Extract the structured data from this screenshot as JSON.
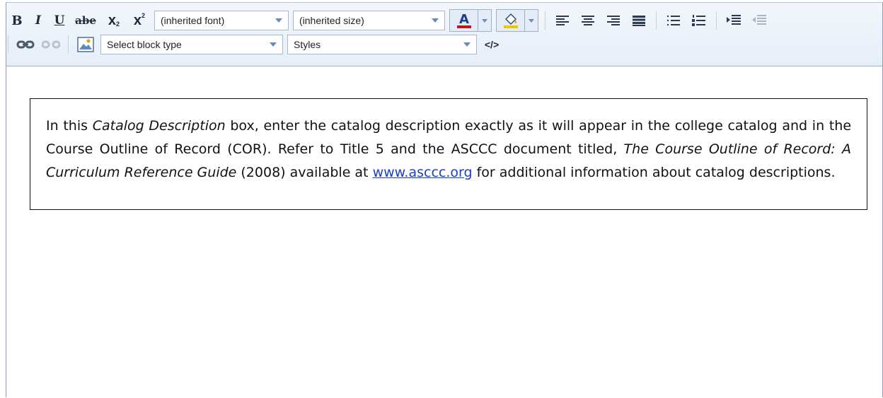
{
  "toolbar": {
    "bold": "B",
    "italic": "I",
    "underline": "U",
    "strike": "abe",
    "subscript_main": "x",
    "subscript_small": "2",
    "superscript_main": "x",
    "superscript_small": "2",
    "font_select": "(inherited font)",
    "size_select": "(inherited size)",
    "font_color_glyph": "A",
    "font_color": "#c01818",
    "block_select": "Select block type",
    "styles_select": "Styles",
    "source_glyph": "</>"
  },
  "content": {
    "p1": "In this ",
    "catalog_em": "Catalog Description",
    "p2": " box, enter the catalog description exactly as it will appear in the college catalog and in the Course Outline of Record (COR).  Refer to Title 5 and the ASCCC document titled, ",
    "cor_em": "The Course Outline of Record: A Curriculum Reference Guide",
    "p3": " (2008) available at ",
    "link": "www.asccc.org",
    "p4": " for additional information about catalog descriptions."
  }
}
